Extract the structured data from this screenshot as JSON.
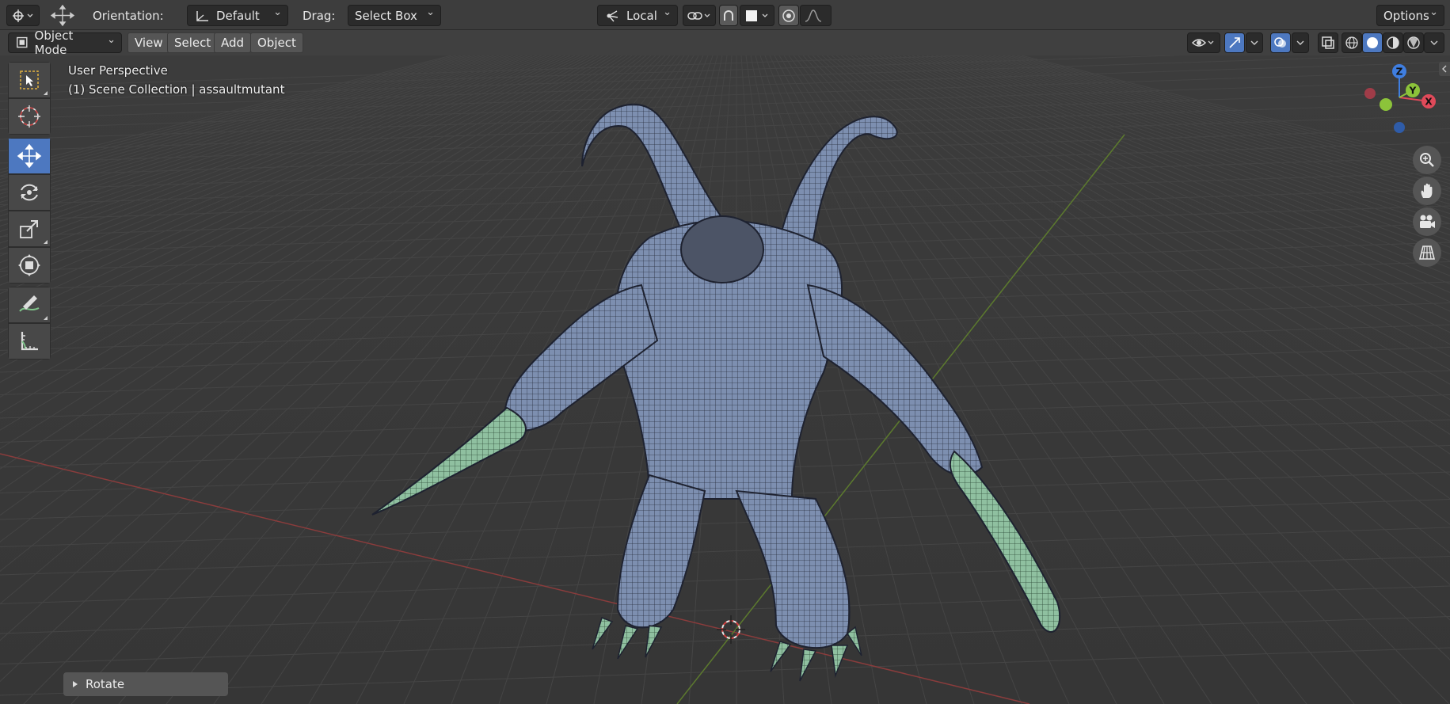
{
  "topbar": {
    "orientation_label": "Orientation:",
    "orientation_value": "Default",
    "drag_label": "Drag:",
    "drag_value": "Select Box",
    "pivot_value": "Local",
    "options_label": "Options"
  },
  "header": {
    "mode": "Object Mode",
    "menus": [
      "View",
      "Select",
      "Add",
      "Object"
    ]
  },
  "viewport": {
    "view_name": "User Perspective",
    "collection_info": "(1) Scene Collection | assaultmutant"
  },
  "gizmo": {
    "z": "Z",
    "y": "Y",
    "x": "X"
  },
  "last_operator": {
    "label": "Rotate"
  },
  "colors": {
    "accent": "#4d78c0",
    "axis_x": "#e04a5a",
    "axis_y": "#8cc33a",
    "axis_z": "#3f7ee0",
    "mesh_body": "#7d8fb0",
    "mesh_selected": "#8fc0a0"
  }
}
